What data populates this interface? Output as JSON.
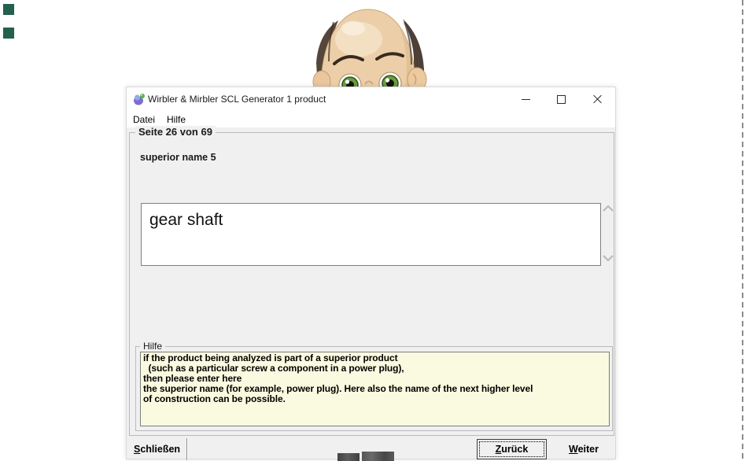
{
  "desktop": {
    "marker_color": "#23604e",
    "fragment_note": "dark-object-fragments-at-bottom-edge"
  },
  "window": {
    "title": "Wirbler & Mirbler SCL Generator 1 product",
    "menu": {
      "items": [
        {
          "label": "Datei"
        },
        {
          "label": "Hilfe"
        }
      ]
    },
    "page_group_label": "Seite 26 von 69",
    "field_label": "superior name 5",
    "field_value": "gear shaft",
    "help_group_label": "Hilfe",
    "help_text": "if the product being analyzed is part of a superior product\n  (such as a particular screw a component in a power plug),\nthen please enter here\nthe superior name (for example, power plug). Here also the name of the next higher level\nof construction can be possible.",
    "buttons": {
      "close": {
        "mnemonic": "S",
        "rest": "chließen"
      },
      "back": {
        "mnemonic": "Z",
        "rest": "urück"
      },
      "next": {
        "mnemonic": "W",
        "rest": "eiter"
      }
    },
    "colors": {
      "client_bg": "#f0f0f0",
      "help_bg": "#fafae0",
      "titlebar_bg": "#ffffff"
    }
  }
}
